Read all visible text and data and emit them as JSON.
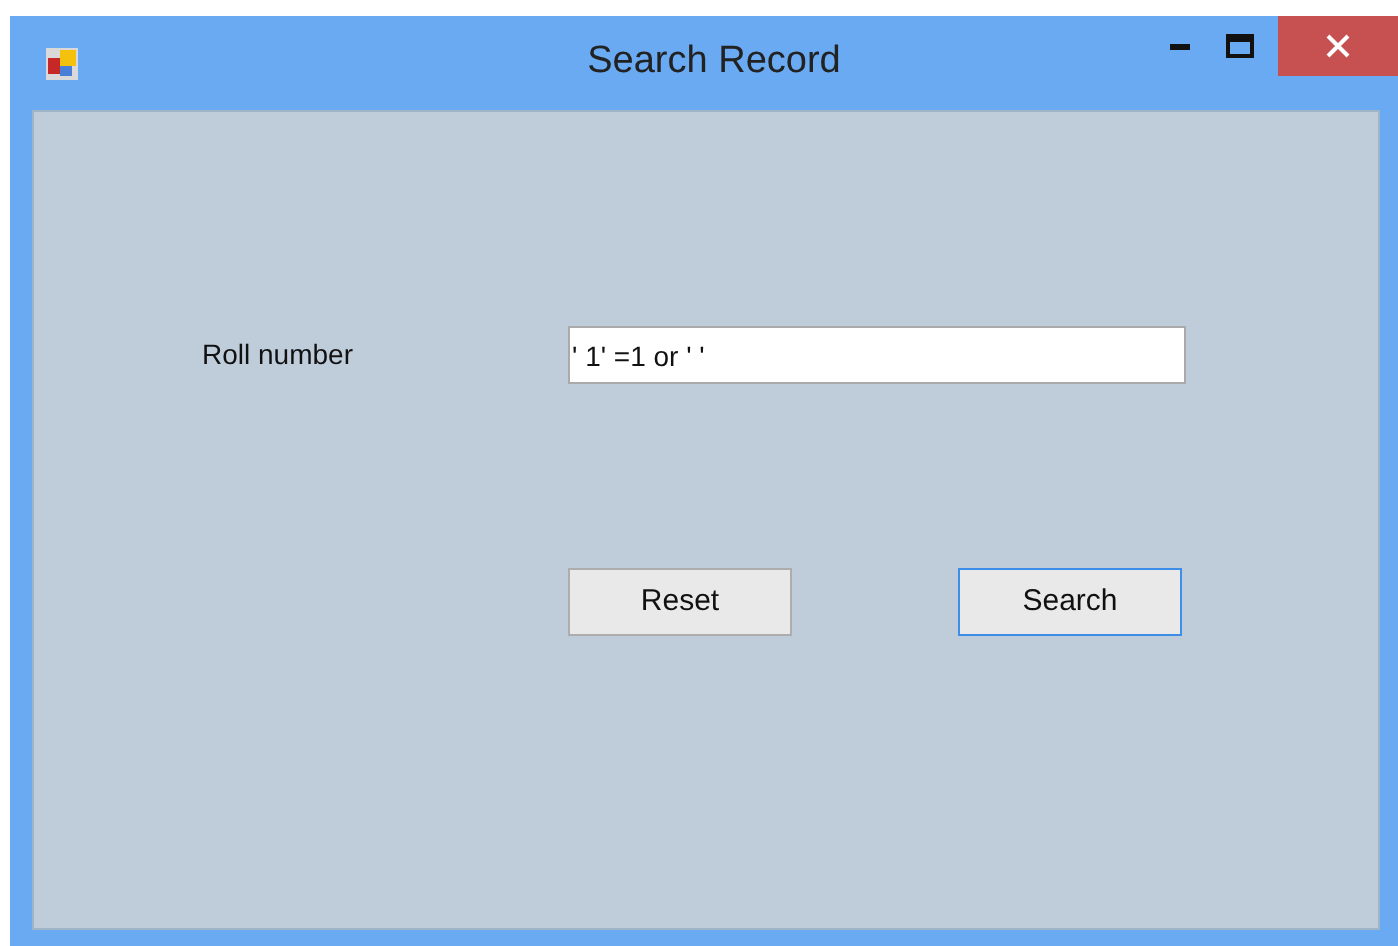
{
  "window": {
    "title": "Search Record"
  },
  "form": {
    "label": "Roll number",
    "value": "' 1' =1 or ' '"
  },
  "buttons": [
    {
      "label": "Reset",
      "focused": false
    },
    {
      "label": "Search",
      "focused": true
    }
  ]
}
